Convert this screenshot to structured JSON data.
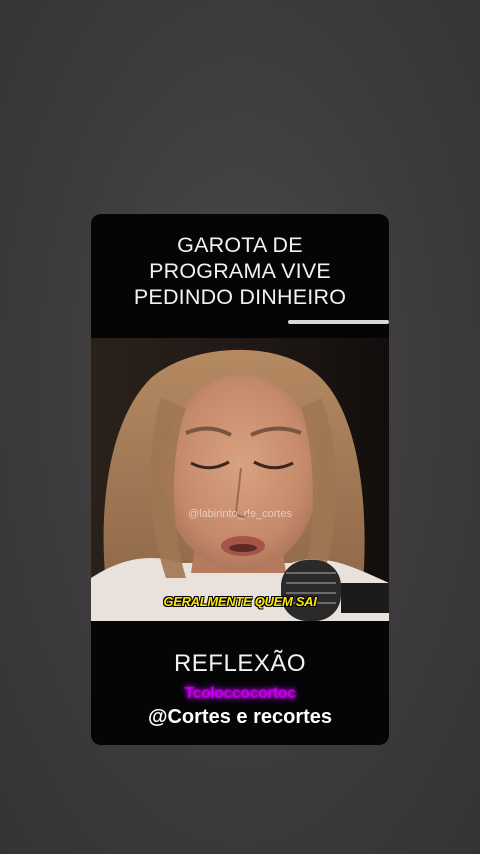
{
  "post": {
    "headline": "GAROTA DE\nPROGRAMA VIVE\nPEDINDO DINHEIRO",
    "progress": 0.34,
    "video": {
      "watermark": "@labirinto_de_cortes",
      "caption": "GERALMENTE QUEM SAI"
    },
    "footer_title": "REFLEXÃO",
    "footer_glitch_text": "Tcoloccocortoc",
    "handle": "@Cortes e recortes"
  },
  "colors": {
    "page_bg": "#3d3b3c",
    "card_bg": "#050505",
    "caption": "#ffe600",
    "glitch": "#c400ff"
  }
}
